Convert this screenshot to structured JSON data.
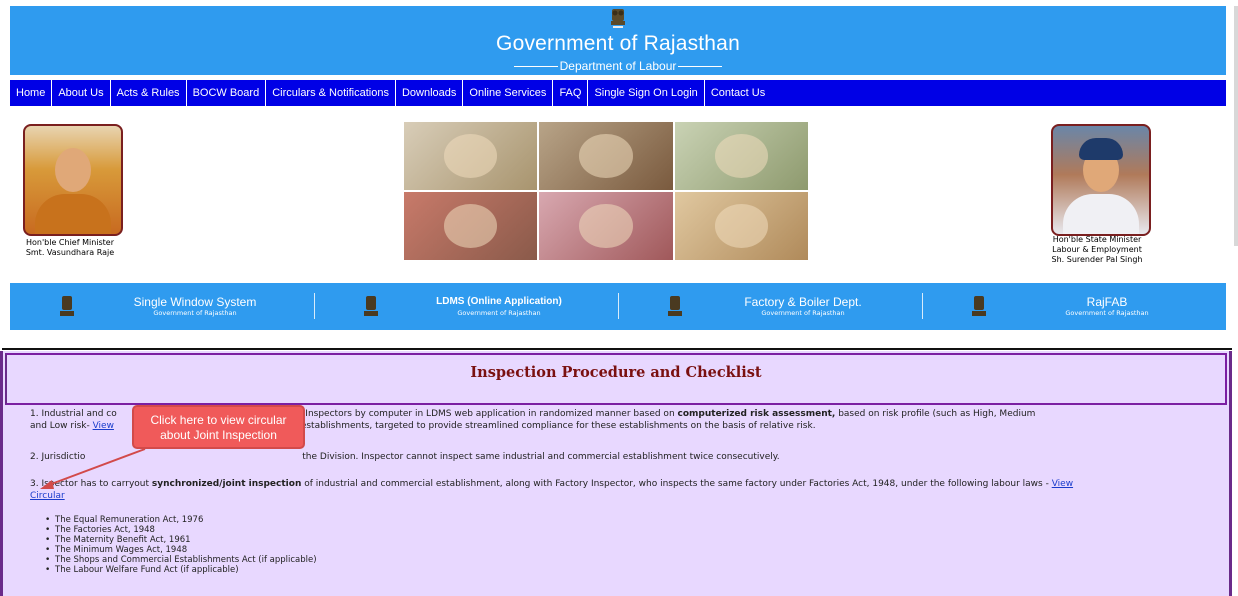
{
  "header": {
    "title": "Government of Rajasthan",
    "department": "Department of Labour",
    "bg_color": "#2f9bef"
  },
  "nav": {
    "bg_color": "#0000e6",
    "items": [
      {
        "label": "Home"
      },
      {
        "label": "About Us"
      },
      {
        "label": "Acts & Rules"
      },
      {
        "label": "BOCW Board"
      },
      {
        "label": "Circulars & Notifications"
      },
      {
        "label": "Downloads"
      },
      {
        "label": "Online Services"
      },
      {
        "label": "FAQ"
      },
      {
        "label": "Single Sign On Login"
      },
      {
        "label": "Contact Us"
      }
    ]
  },
  "banner": {
    "cm_caption_line1": "Hon'ble Chief Minister",
    "cm_caption_line2": "Smt. Vasundhara Raje",
    "minister_caption_line1": "Hon'ble State Minister",
    "minister_caption_line2": "Labour & Employment",
    "minister_caption_line3": "Sh. Surender Pal Singh"
  },
  "portals": [
    {
      "name": "Single Window System",
      "sub": "Government of Rajasthan"
    },
    {
      "name": "LDMS (Online Application)",
      "sub": "Government of Rajasthan"
    },
    {
      "name": "Factory & Boiler Dept.",
      "sub": "Government of Rajasthan"
    },
    {
      "name": "RajFAB",
      "sub": "Government of Rajasthan"
    }
  ],
  "content": {
    "heading": "Inspection Procedure and Checklist",
    "heading_color": "#7a1010",
    "p1_part1": "1. Industrial and co",
    "p1_part2": "s are alloted to Inspectors by computer in LDMS web application in randomized manner based on ",
    "p1_bold": "computerized risk assessment,",
    "p1_part3": " based on risk profile (such as High, Medium",
    "p1_line2_start": "and Low risk- ",
    "p1_link": "View",
    "p1_line2_end": " establishments, targeted to provide streamlined compliance for these establishments on the basis of relative risk.",
    "p2_start": "2. Jurisdictio",
    "p2_end": " the Division. Inspector cannot inspect same industrial and commercial establishment twice consecutively.",
    "p3_start": "3. I",
    "p3_mid": "spector has to carryout ",
    "p3_bold": "synchronized/joint inspection",
    "p3_end": " of industrial and commercial establishment, along with Factory Inspector, who inspects the same factory under Factories Act, 1948, under the following labour laws - ",
    "p3_link_1": "View",
    "p3_link_2": "Circular",
    "laws": [
      "The Equal Remuneration Act, 1976",
      "The Factories Act, 1948",
      "The Maternity Benefit Act, 1961",
      "The Minimum Wages Act, 1948",
      "The Shops and Commercial Establishments Act (if applicable)",
      "The Labour Welfare Fund Act (if applicable)"
    ]
  },
  "callout": {
    "line1": "Click here to view circular",
    "line2": "about Joint Inspection",
    "color": "#f05a5a"
  }
}
